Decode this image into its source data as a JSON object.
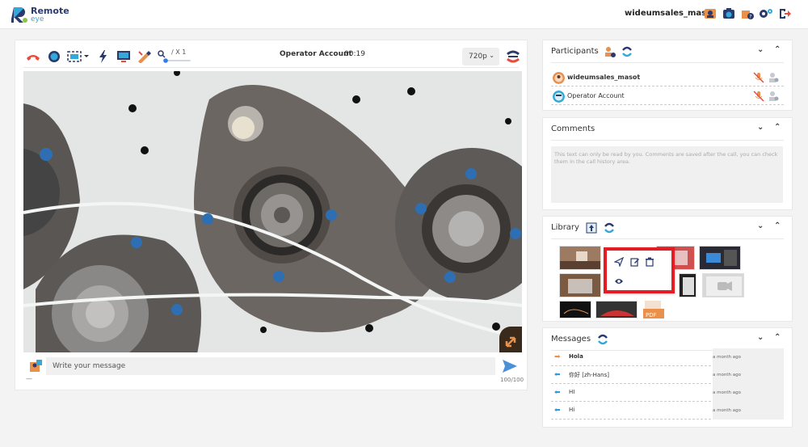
{
  "app": {
    "brand_line1": "Remote",
    "brand_line2": "eye",
    "username": "wideumsales_masot"
  },
  "colors": {
    "accent": "#34a8d8",
    "brand_dark": "#2a3a6c",
    "hangup": "#e74c3c",
    "highlight": "#e51c23",
    "outgoing_arrow": "#e8904c",
    "incoming_arrow": "#3498db"
  },
  "top_icons": [
    "support-icon",
    "camera-user-icon",
    "help-user-icon",
    "settings-icon",
    "logout-icon"
  ],
  "call": {
    "title": "Operator Account",
    "time": "00:19",
    "zoom_label": "/ X 1",
    "quality": "720p"
  },
  "toolbar": [
    "hangup-icon",
    "record-icon",
    "screenshot-icon",
    "flash-icon",
    "screen-share-icon",
    "draw-icon",
    "zoom-icon"
  ],
  "message": {
    "placeholder": "Write your message",
    "counter": "100/100",
    "dash": "—"
  },
  "participants": {
    "title": "Participants",
    "list": [
      {
        "name": "wideumsales_masot",
        "bold": true
      },
      {
        "name": "Operator Account",
        "bold": false
      }
    ]
  },
  "comments": {
    "title": "Comments",
    "placeholder": "This text can only be read by you. Comments are saved after the call, you can check them in the call history area."
  },
  "library": {
    "title": "Library",
    "pdf_label": "PDF"
  },
  "messages": {
    "title": "Messages",
    "list": [
      {
        "text": "Hola",
        "time": "a month ago",
        "direction": "out"
      },
      {
        "text": "你好 [zh-Hans]",
        "time": "a month ago",
        "direction": "in"
      },
      {
        "text": "HI",
        "time": "a month ago",
        "direction": "in"
      },
      {
        "text": "Hi",
        "time": "a month ago",
        "direction": "in"
      }
    ]
  },
  "controls": {
    "collapse": "⌄",
    "expand": "⌃"
  }
}
